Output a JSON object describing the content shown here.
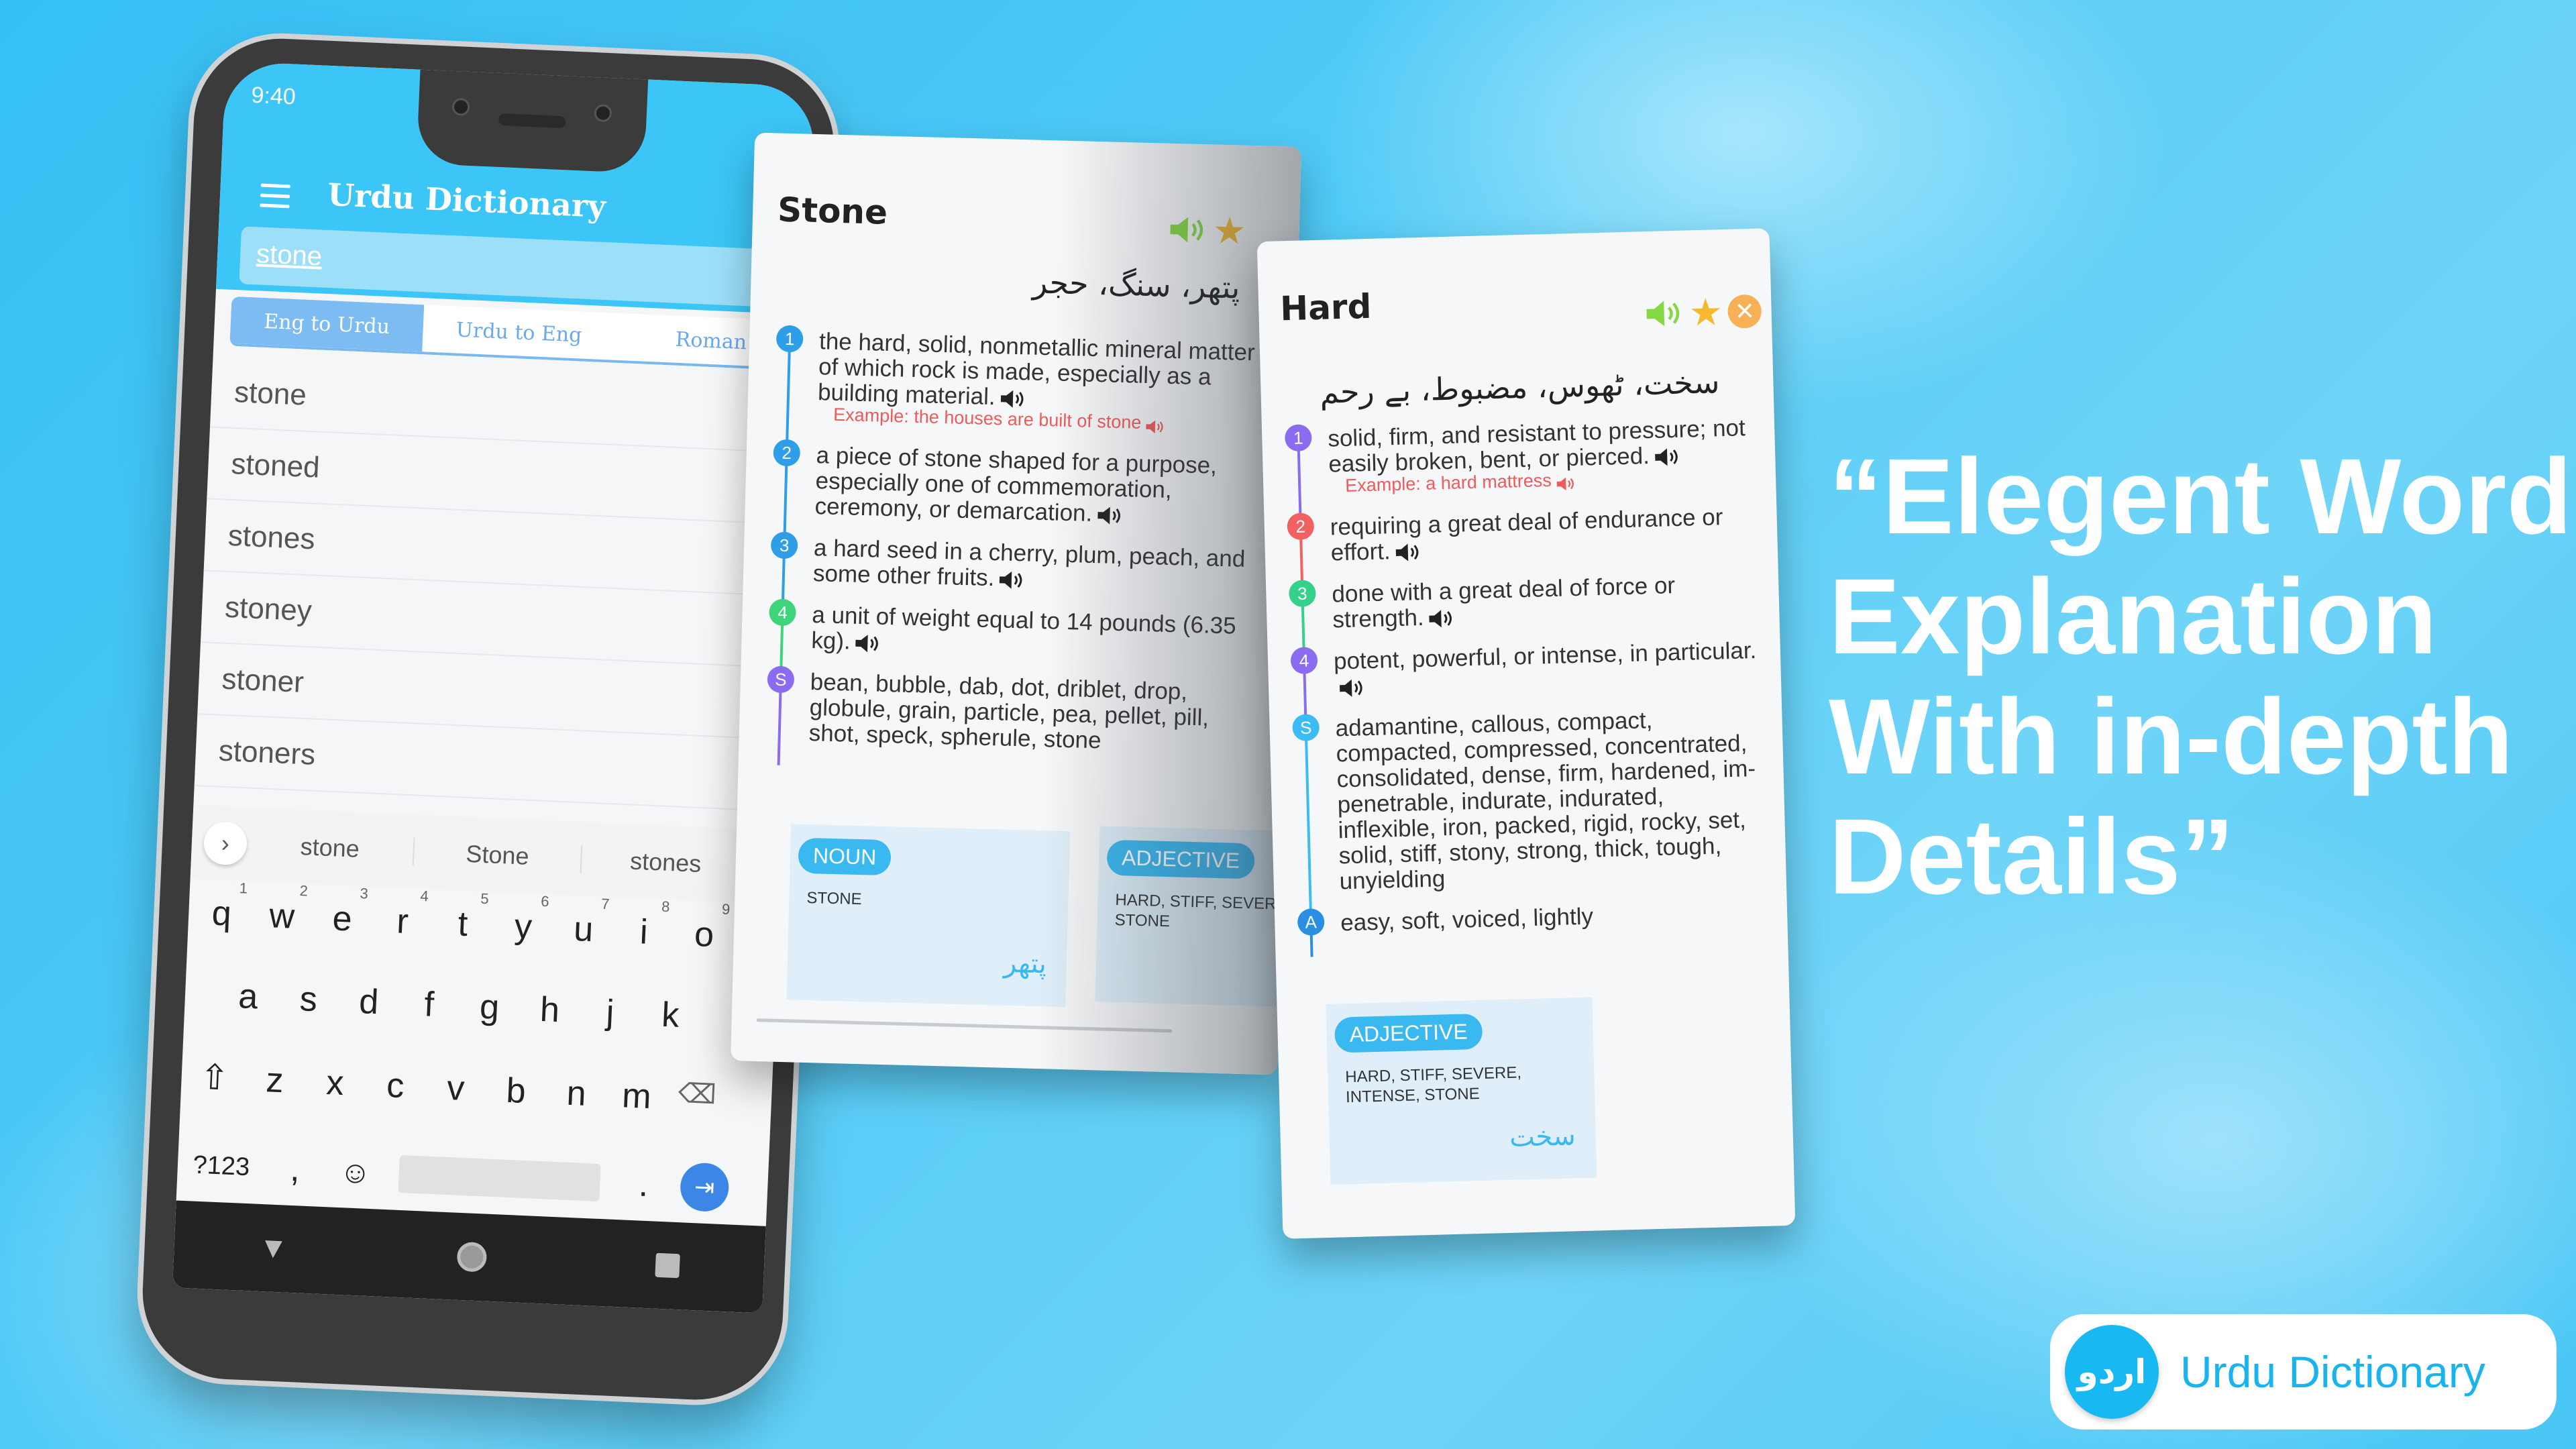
{
  "phone": {
    "status_time": "9:40",
    "app_title": "Urdu Dictionary",
    "search_value": "stone",
    "tabs": [
      {
        "label": "Eng to Urdu",
        "active": true
      },
      {
        "label": "Urdu to Eng",
        "active": false
      },
      {
        "label": "Roman",
        "active": false
      }
    ],
    "words": [
      "stone",
      "stoned",
      "stones",
      "stoney",
      "stoner",
      "stoners"
    ],
    "suggestions": [
      "stone",
      "Stone",
      "stones"
    ],
    "keyboard": {
      "row1": [
        "q",
        "w",
        "e",
        "r",
        "t",
        "y",
        "u",
        "i",
        "o"
      ],
      "row1_nums": [
        "1",
        "2",
        "3",
        "4",
        "5",
        "6",
        "7",
        "8",
        "9"
      ],
      "row2": [
        "a",
        "s",
        "d",
        "f",
        "g",
        "h",
        "j",
        "k"
      ],
      "row3": [
        "z",
        "x",
        "c",
        "v",
        "b",
        "n",
        "m"
      ],
      "symbols_key": "?123",
      "comma": ",",
      "period": "."
    }
  },
  "stone_card": {
    "title": "Stone",
    "urdu": "پتھر، سنگ، حجر",
    "definitions": [
      {
        "marker": "1",
        "color": "#2f9ee8",
        "text": "the hard, solid, nonmetallic mineral matter of which rock is made, especially as a building material.",
        "speaker": true,
        "example": "Example: the houses are built of stone"
      },
      {
        "marker": "2",
        "color": "#2f9ee8",
        "text": "a piece of stone shaped for a purpose, especially one of commemoration, ceremony, or demarcation.",
        "speaker": true
      },
      {
        "marker": "3",
        "color": "#2f9ee8",
        "text": "a hard seed in a cherry, plum, peach, and some other fruits.",
        "speaker": true
      },
      {
        "marker": "4",
        "color": "#3ed47a",
        "text": "a unit of weight equal to 14 pounds (6.35 kg).",
        "speaker": true
      },
      {
        "marker": "S",
        "color": "#8b6cf0",
        "text": "bean, bubble, dab, dot, driblet, drop, globule, grain, particle, pea, pellet, pill, shot, speck, spherule, stone",
        "speaker": false
      }
    ],
    "pos": [
      {
        "label": "NOUN",
        "words": "STONE",
        "urdu": "پتھر"
      },
      {
        "label": "ADJECTIVE",
        "words": "HARD, STIFF, SEVERE, STONE",
        "urdu": ""
      }
    ]
  },
  "hard_card": {
    "title": "Hard",
    "urdu": "سخت، ٹھوس، مضبوط، بے رحم",
    "definitions": [
      {
        "marker": "1",
        "color": "#8a6cf0",
        "text": "solid, firm, and resistant to pressure; not easily broken, bent, or pierced.",
        "speaker": true,
        "example": "Example: a hard mattress"
      },
      {
        "marker": "2",
        "color": "#f26060",
        "text": "requiring a great deal of endurance or effort.",
        "speaker": true
      },
      {
        "marker": "3",
        "color": "#35d08a",
        "text": "done with a great deal of force or strength.",
        "speaker": true
      },
      {
        "marker": "4",
        "color": "#8a6cf0",
        "text": "potent, powerful, or intense, in particular.",
        "speaker": true
      },
      {
        "marker": "S",
        "color": "#3bbcf5",
        "text": "adamantine, callous, compact, compacted, compressed, concentrated, consolidated, dense, firm, hardened, im-penetrable, indurate, indurated, inflexible, iron, packed, rigid, rocky, set, solid, stiff, stony, strong, thick, tough, unyielding",
        "speaker": false
      },
      {
        "marker": "A",
        "color": "#2a8fe0",
        "text": "easy, soft, voiced, lightly",
        "speaker": false
      }
    ],
    "pos": [
      {
        "label": "ADJECTIVE",
        "words": "HARD, STIFF, SEVERE, INTENSE, STONE",
        "urdu": "سخت"
      }
    ]
  },
  "headline": [
    "“Elegent Word",
    "Explanation",
    "With in-depth",
    "Details”"
  ],
  "logo": {
    "urdu": "اردو",
    "text": "Urdu Dictionary"
  },
  "colors": {
    "accent": "#3cc6f7",
    "speaker_green": "#84d943",
    "star": "#f5b82e",
    "close": "#f7b055",
    "example_red": "#f05a5a"
  },
  "icons": {
    "menu": "hamburger-icon",
    "speaker": "speaker-icon",
    "favorite": "star-icon",
    "close": "close-icon",
    "enter": "tab-enter-icon",
    "backspace": "backspace-icon",
    "shift": "shift-icon",
    "emoji": "emoji-icon"
  }
}
